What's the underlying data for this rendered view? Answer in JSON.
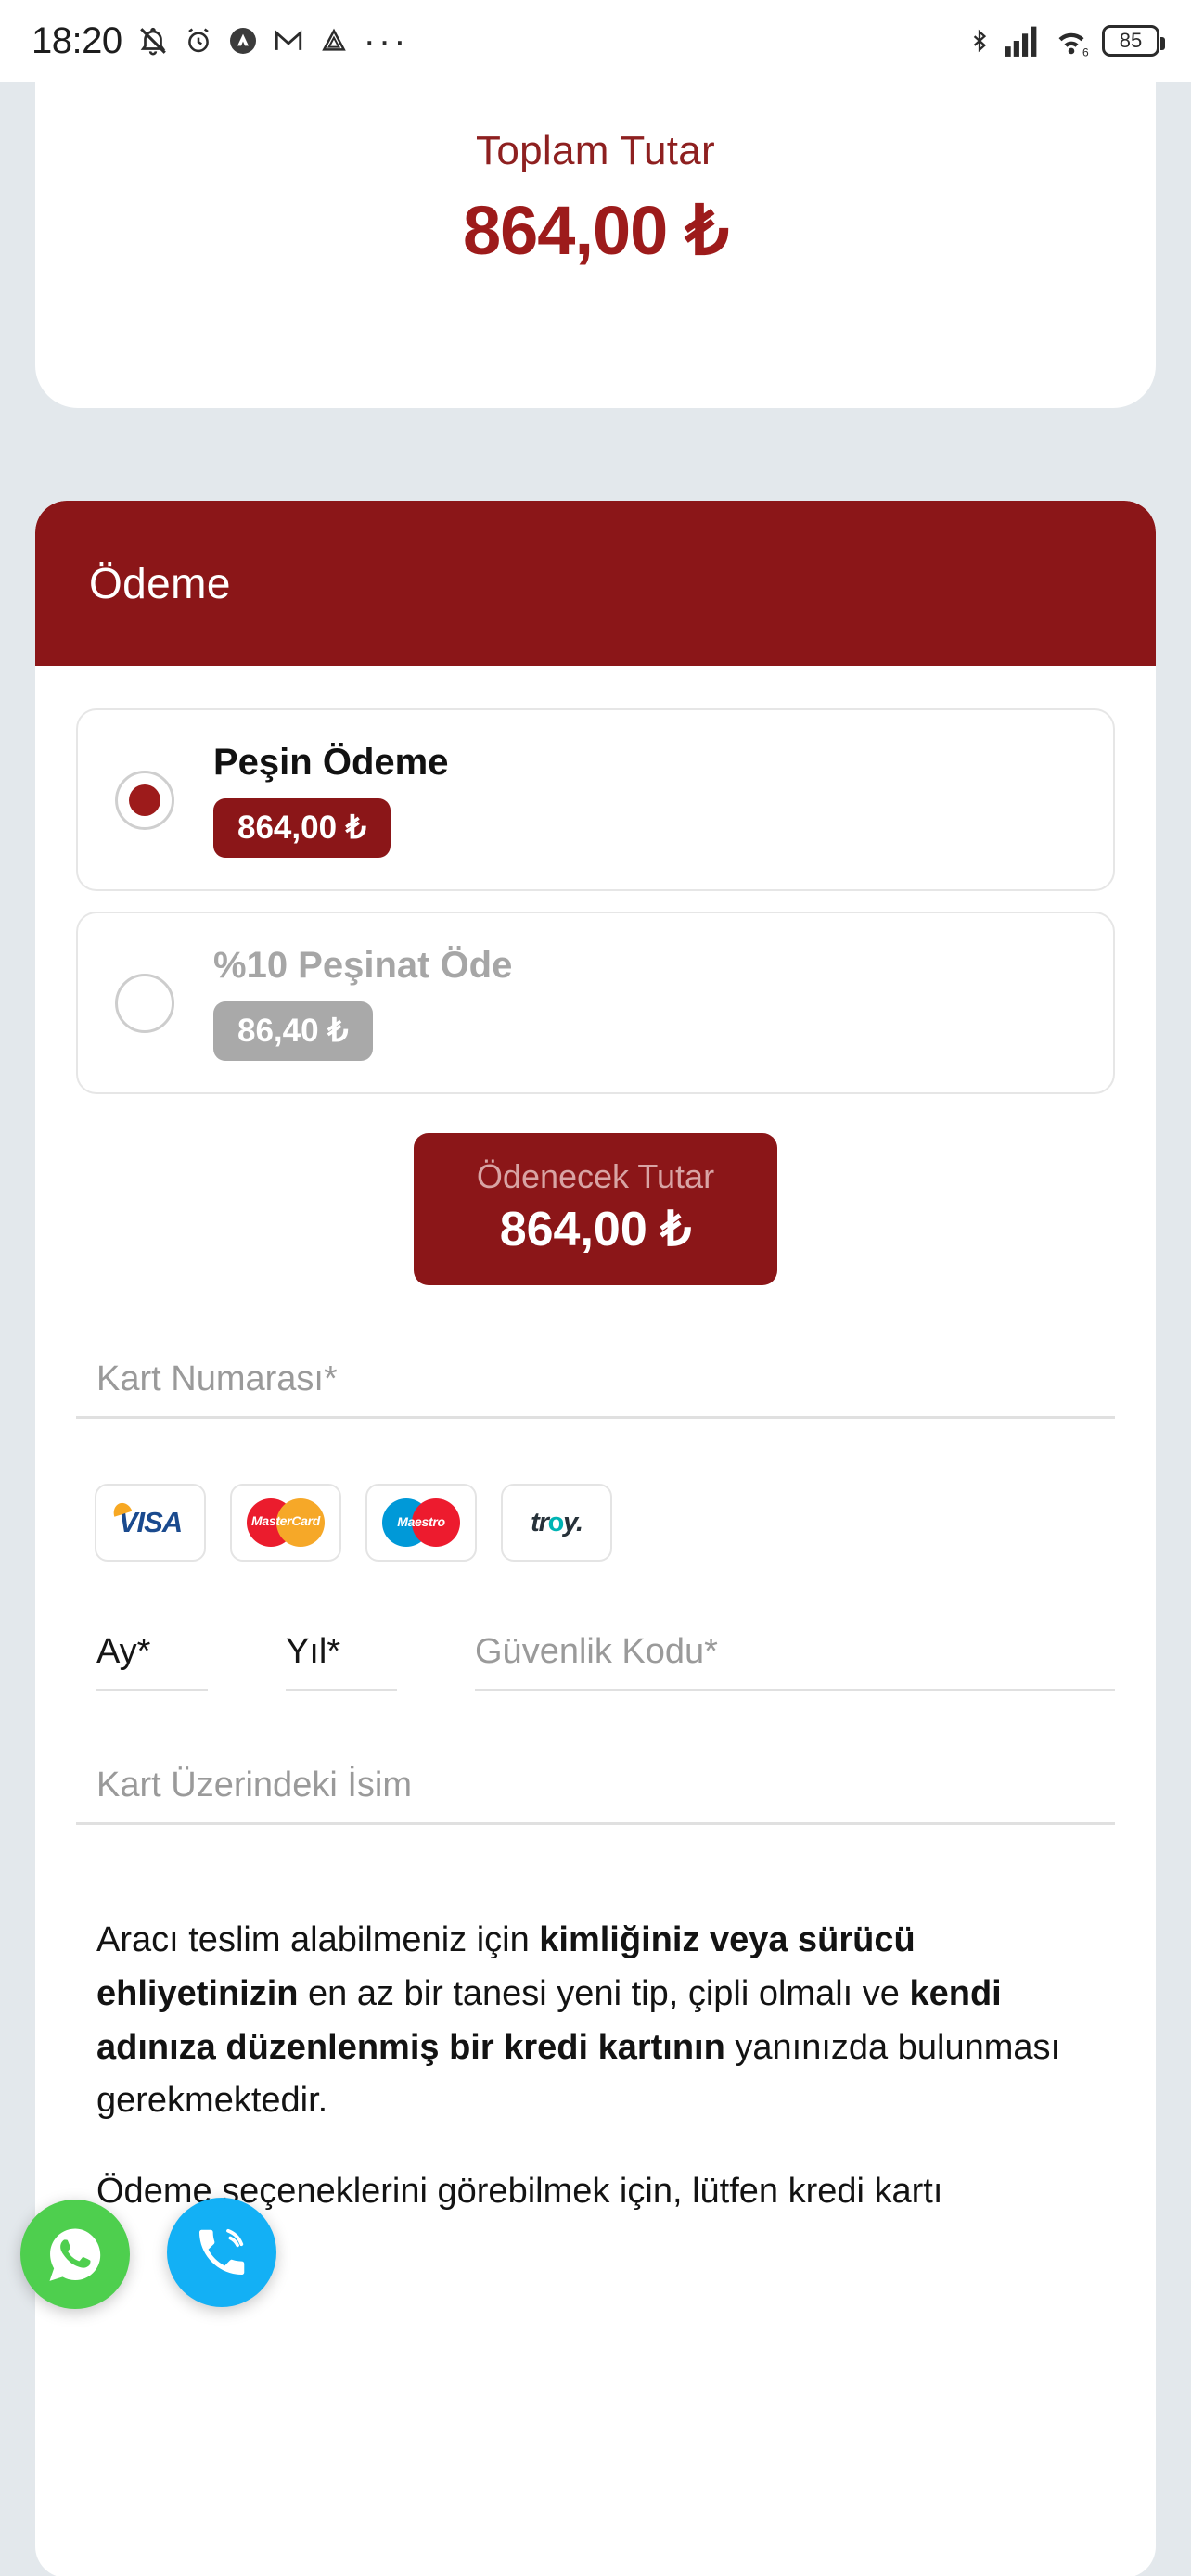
{
  "status_bar": {
    "time": "18:20",
    "left_icons": [
      "bell-muted-icon",
      "alarm-icon",
      "app-circle-icon",
      "gmail-icon",
      "drive-icon",
      "overflow-dots-icon"
    ],
    "right_icons": [
      "bluetooth-icon",
      "cellular-signal-icon",
      "wifi-6-icon"
    ],
    "battery_level": "85"
  },
  "total_card": {
    "label": "Toplam Tutar",
    "amount": "864,00 ₺"
  },
  "payment": {
    "header_title": "Ödeme",
    "options": [
      {
        "title": "Peşin Ödeme",
        "badge": "864,00 ₺",
        "selected": true,
        "disabled": false
      },
      {
        "title": "%10 Peşinat Öde",
        "badge": "86,40 ₺",
        "selected": false,
        "disabled": true
      }
    ],
    "payable": {
      "label": "Ödenecek Tutar",
      "amount": "864,00 ₺"
    },
    "card_number_placeholder": "Kart Numarası*",
    "card_brands": [
      {
        "name": "visa-logo",
        "label": "VISA"
      },
      {
        "name": "mastercard-logo",
        "label": "MasterCard"
      },
      {
        "name": "maestro-logo",
        "label": "Maestro"
      },
      {
        "name": "troy-logo",
        "label_a": "tr",
        "label_o": "o",
        "label_b": "y."
      }
    ],
    "month_label": "Ay*",
    "year_label": "Yıl*",
    "cvc_placeholder": "Güvenlik Kodu*",
    "card_holder_placeholder": "Kart Üzerindeki İsim"
  },
  "info": {
    "part1": "Aracı teslim alabilmeniz için ",
    "bold1": "kimliğiniz veya sürücü ehliyetinizin",
    "part2": " en az bir tanesi yeni tip, çipli olmalı ve ",
    "bold2": "kendi adınıza düzenlenmiş bir kredi kartının",
    "part3": " yanınızda bulunması gerekmektedir.",
    "part4": "Ödeme seçeneklerini görebilmek için, lütfen kredi kartı"
  },
  "fabs": [
    {
      "name": "whatsapp-fab",
      "icon": "whatsapp-icon",
      "color": "#4ecf4e"
    },
    {
      "name": "call-fab",
      "icon": "phone-call-icon",
      "color": "#13b0f5"
    }
  ],
  "colors": {
    "brand_red": "#8b1618",
    "amount_red": "#9d1b1b",
    "page_bg": "#e3e8ec"
  }
}
